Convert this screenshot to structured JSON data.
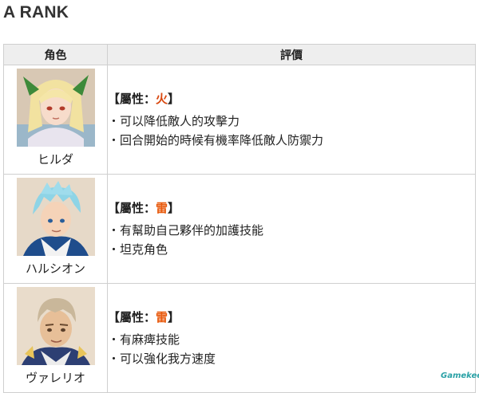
{
  "page": {
    "section_title": "A RANK"
  },
  "table": {
    "headers": {
      "character": "角色",
      "evaluation": "評價"
    },
    "rows": [
      {
        "name": "ヒルダ",
        "attr_prefix": "【屬性：",
        "attr_value": "火",
        "attr_suffix": "】",
        "points": [
          "・可以降低敵人的攻擊力",
          "・回合開始的時候有機率降低敵人防禦力"
        ]
      },
      {
        "name": "ハルシオン",
        "attr_prefix": "【屬性：",
        "attr_value": "雷",
        "attr_suffix": "】",
        "points": [
          "・有幫助自己夥伴的加護技能",
          "・坦克角色"
        ]
      },
      {
        "name": "ヴァレリオ",
        "attr_prefix": "【屬性：",
        "attr_value": "雷",
        "attr_suffix": "】",
        "points": [
          "・有麻痺技能",
          "・可以強化我方速度"
        ]
      }
    ]
  },
  "watermark": {
    "text": "Gamekee"
  },
  "colors": {
    "fire": "#d9480f",
    "thunder": "#e8590c",
    "header_bg": "#eeeeee",
    "border": "#cfcfcf"
  }
}
